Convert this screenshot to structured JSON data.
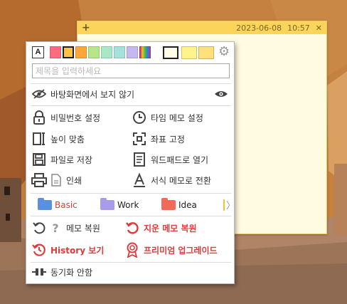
{
  "note": {
    "add_label": "+",
    "date": "2023-06-08",
    "time": "10:57",
    "close_label": "✕"
  },
  "menu": {
    "font_button": "A",
    "colors": [
      "#ff6b81",
      "#ffc247",
      "#ffa837",
      "#b5e68a",
      "#a9e8c6",
      "#a6e0dd",
      "#c5b8f0",
      "rainbow"
    ],
    "note_colors": [
      "#fffde6",
      "#fff48a",
      "#ffe07a"
    ],
    "title_placeholder": "제목을 입력하세요",
    "hide_label": "바탕화면에서 보지 않기",
    "items": {
      "password": "비밀번호 설정",
      "timer_memo": "타임 메모 설정",
      "fit_height": "높이 맞춤",
      "fix_position": "좌표 고정",
      "save_file": "파일로 저장",
      "open_wordpad": "워드패드로 열기",
      "print": "인쇄",
      "format_memo": "서식 메모로 전환",
      "restore_memo": "메모 복원",
      "restore_deleted": "지운 메모 복원",
      "history": "History 보기",
      "premium": "프리미엄 업그레이드",
      "sync": "동기화 안함"
    },
    "tags": [
      {
        "label": "Basic",
        "color": "#5b8fe0",
        "text_color": "#e03a3a"
      },
      {
        "label": "Work",
        "color": "#a99be8",
        "text_color": "#333333"
      },
      {
        "label": "Idea",
        "color": "#f26b5a",
        "text_color": "#333333"
      }
    ],
    "more_label": "〉"
  }
}
